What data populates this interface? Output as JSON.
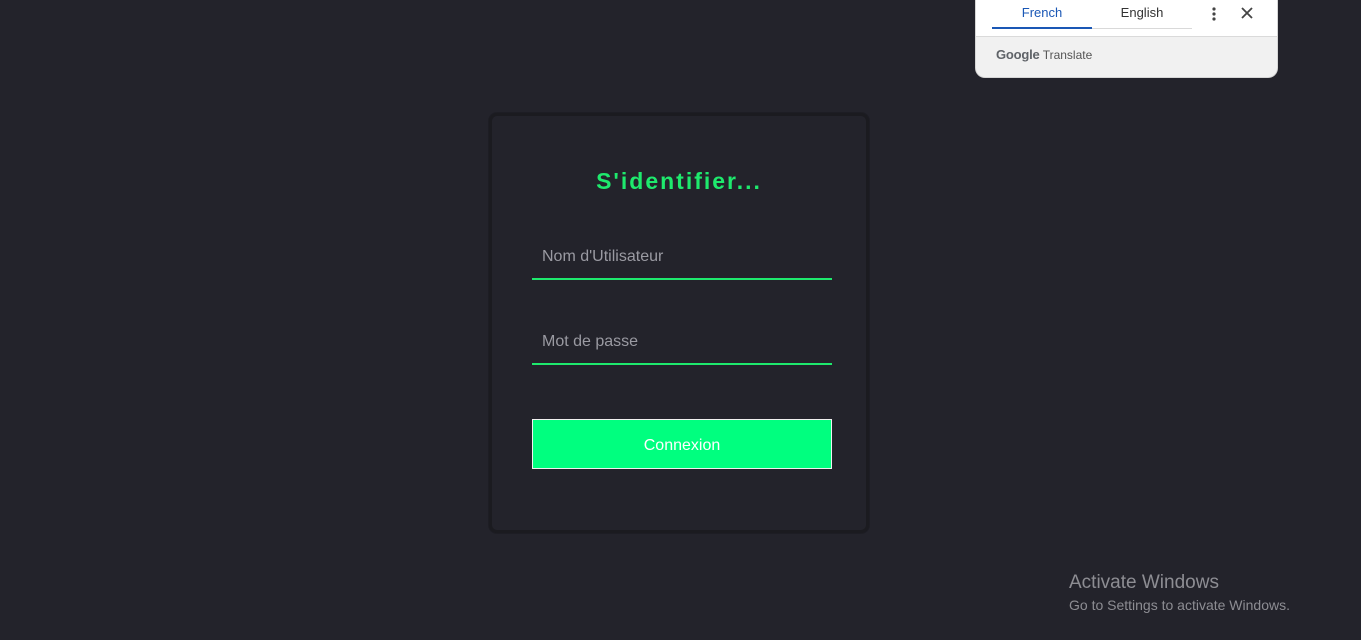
{
  "login": {
    "title": "S'identifier...",
    "username_placeholder": "Nom d'Utilisateur",
    "password_placeholder": "Mot de passe",
    "submit_label": "Connexion",
    "colors": {
      "accent": "#1ee96d",
      "button": "#00ff7f",
      "side_glow": "#c11ad2",
      "background": "#23232b"
    }
  },
  "translate_popup": {
    "tabs": [
      {
        "label": "French",
        "active": true
      },
      {
        "label": "English",
        "active": false
      }
    ],
    "more_icon": "more-vert-icon",
    "close_icon": "close-icon",
    "brand_google": "Google",
    "brand_translate": "Translate"
  },
  "watermark": {
    "title": "Activate Windows",
    "subtitle": "Go to Settings to activate Windows."
  }
}
